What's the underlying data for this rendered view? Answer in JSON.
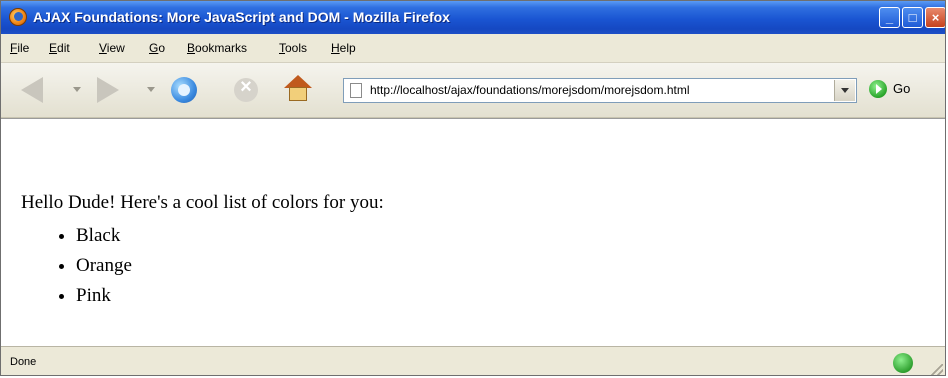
{
  "window": {
    "title": "AJAX Foundations: More JavaScript and DOM - Mozilla Firefox",
    "controls": {
      "minimize": "_",
      "maximize": "□",
      "close": "×"
    }
  },
  "menu": {
    "items": [
      "File",
      "Edit",
      "View",
      "Go",
      "Bookmarks",
      "Tools",
      "Help"
    ]
  },
  "toolbar": {
    "url": "http://localhost/ajax/foundations/morejsdom/morejsdom.html",
    "go_label": "Go",
    "icons": [
      "back-arrow",
      "forward-arrow",
      "reload",
      "stop",
      "home",
      "go"
    ]
  },
  "page": {
    "intro": "Hello Dude! Here's a cool list of colors for you:",
    "colors": [
      "Black",
      "Orange",
      "Pink"
    ]
  },
  "status": {
    "text": "Done"
  }
}
